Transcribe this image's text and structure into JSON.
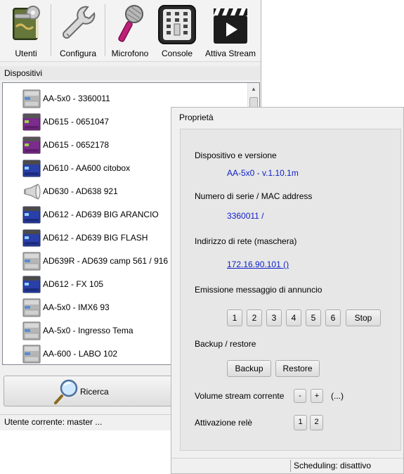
{
  "toolbar": {
    "utenti": "Utenti",
    "configura": "Configura",
    "microfono": "Microfono",
    "console": "Console",
    "attiva_stream": "Attiva Stream"
  },
  "devices": {
    "header": "Dispositivi",
    "items": [
      {
        "label": "AA-5x0 - 3360011",
        "icon": "device-grey-icon"
      },
      {
        "label": "AD615 - 0651047",
        "icon": "device-purple-icon"
      },
      {
        "label": "AD615 - 0652178",
        "icon": "device-purple-icon"
      },
      {
        "label": "AD610 - AA600 citobox",
        "icon": "device-blue-icon"
      },
      {
        "label": "AD630 - AD638 921",
        "icon": "horn-speaker-icon"
      },
      {
        "label": "AD612 - AD639 BIG ARANCIO",
        "icon": "device-blue-icon"
      },
      {
        "label": "AD612 - AD639 BIG FLASH",
        "icon": "device-blue-icon"
      },
      {
        "label": "AD639R - AD639 camp 561 / 916",
        "icon": "device-grey-icon"
      },
      {
        "label": "AD612 - FX 105",
        "icon": "device-blue-icon"
      },
      {
        "label": "AA-5x0 - IMX6 93",
        "icon": "device-grey-icon"
      },
      {
        "label": "AA-5x0 - Ingresso Tema",
        "icon": "device-grey-icon"
      },
      {
        "label": "AA-600 - LABO 102",
        "icon": "device-grey-icon"
      }
    ]
  },
  "search_button": "Ricerca",
  "status_bar": "Utente corrente: master  ...",
  "properties": {
    "title": "Proprietà",
    "device_version_label": "Dispositivo e versione",
    "device_version_value": "AA-5x0 - v.1.10.1m",
    "serial_label": "Numero di serie / MAC address",
    "serial_value": "3360011 /",
    "network_label": "Indirizzo di rete (maschera)",
    "network_value": "172.16.90.101 ()",
    "announce_label": "Emissione messaggio di annuncio",
    "announce_buttons": [
      "1",
      "2",
      "3",
      "4",
      "5",
      "6"
    ],
    "stop_button": "Stop",
    "backup_label": "Backup / restore",
    "backup_button": "Backup",
    "restore_button": "Restore",
    "volume_label": "Volume stream corrente",
    "volume_minus": "-",
    "volume_plus": "+",
    "volume_value": "(...)",
    "relay_label": "Attivazione relè",
    "relay_buttons": [
      "1",
      "2"
    ],
    "scheduling_status": "Scheduling: disattivo"
  },
  "colors": {
    "link_blue": "#1020c8",
    "device_grey": "#a8a8a8",
    "device_purple": "#7b2c8c",
    "device_blue": "#2a3fa8"
  }
}
